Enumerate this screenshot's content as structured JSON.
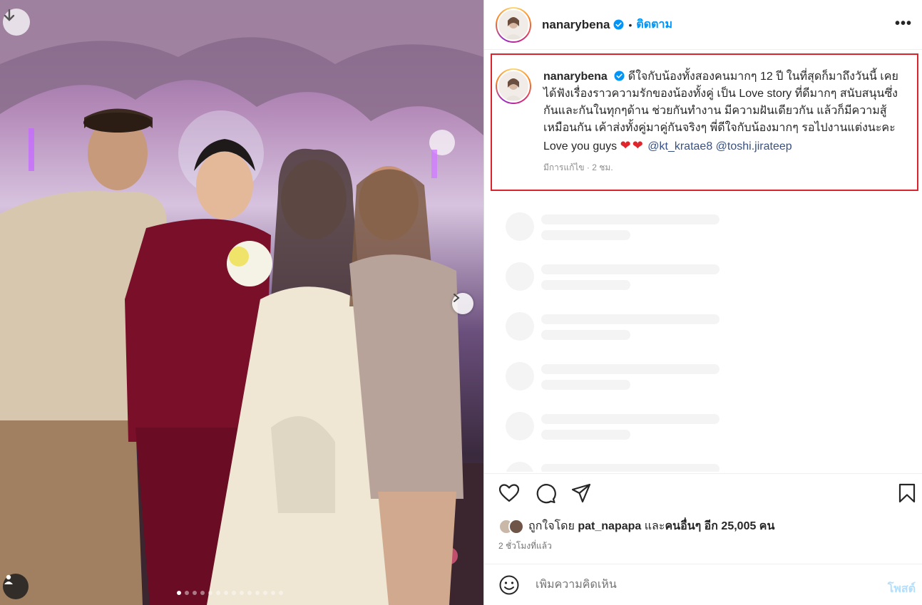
{
  "header": {
    "username": "nanarybena",
    "separator": "•",
    "follow_label": "ติดตาม",
    "more_label": "•••"
  },
  "caption": {
    "username": "nanarybena",
    "text": "ดีใจกับน้องทั้งสองคนมากๆ 12 ปี ในที่สุดก็มาถึงวันนี้ เคยได้ฟังเรื่องราวความรักของน้องทั้งคู่ เป็น Love story ที่ดีมากๆ สนับสนุนซึ่งกันและกันในทุกๆด้าน ช่วยกันทำงาน มีความฝันเดียวกัน แล้วก็มีความสู้เหมือนกัน เค้าส่งทั้งคู่มาคู่กันจริงๆ พี่ดีใจกับน้องมากๆ รอไปงานแต่งนะคะ Love you guys",
    "hearts": "❤❤",
    "mention_1": "@kt_kratae8",
    "mention_2": "@toshi.jirateep",
    "meta": "มีการแก้ไข · 2 ชม."
  },
  "likes": {
    "prefix": "ถูกใจโดย ",
    "user": "pat_napapa",
    "middle": " และ",
    "others": "คนอื่นๆ อีก 25,005 คน"
  },
  "time_ago": "2 ชั่วโมงที่แล้ว",
  "comment": {
    "placeholder": "เพิ่มความคิดเห็น",
    "post_label": "โพสต์"
  },
  "icons": {
    "download": "arrow-down-icon",
    "next": "chevron-right-icon",
    "tag": "user-tag-icon",
    "verified": "verified-badge-icon",
    "like": "heart-icon",
    "comment": "comment-bubble-icon",
    "share": "paper-plane-icon",
    "save": "bookmark-icon",
    "emoji": "smiley-icon"
  },
  "colors": {
    "accent": "#0095f6",
    "highlight_box": "#d9232d",
    "mention": "#385185",
    "heart": "#e0262c"
  },
  "carousel": {
    "total_slides": 14,
    "active_slide": 1
  }
}
